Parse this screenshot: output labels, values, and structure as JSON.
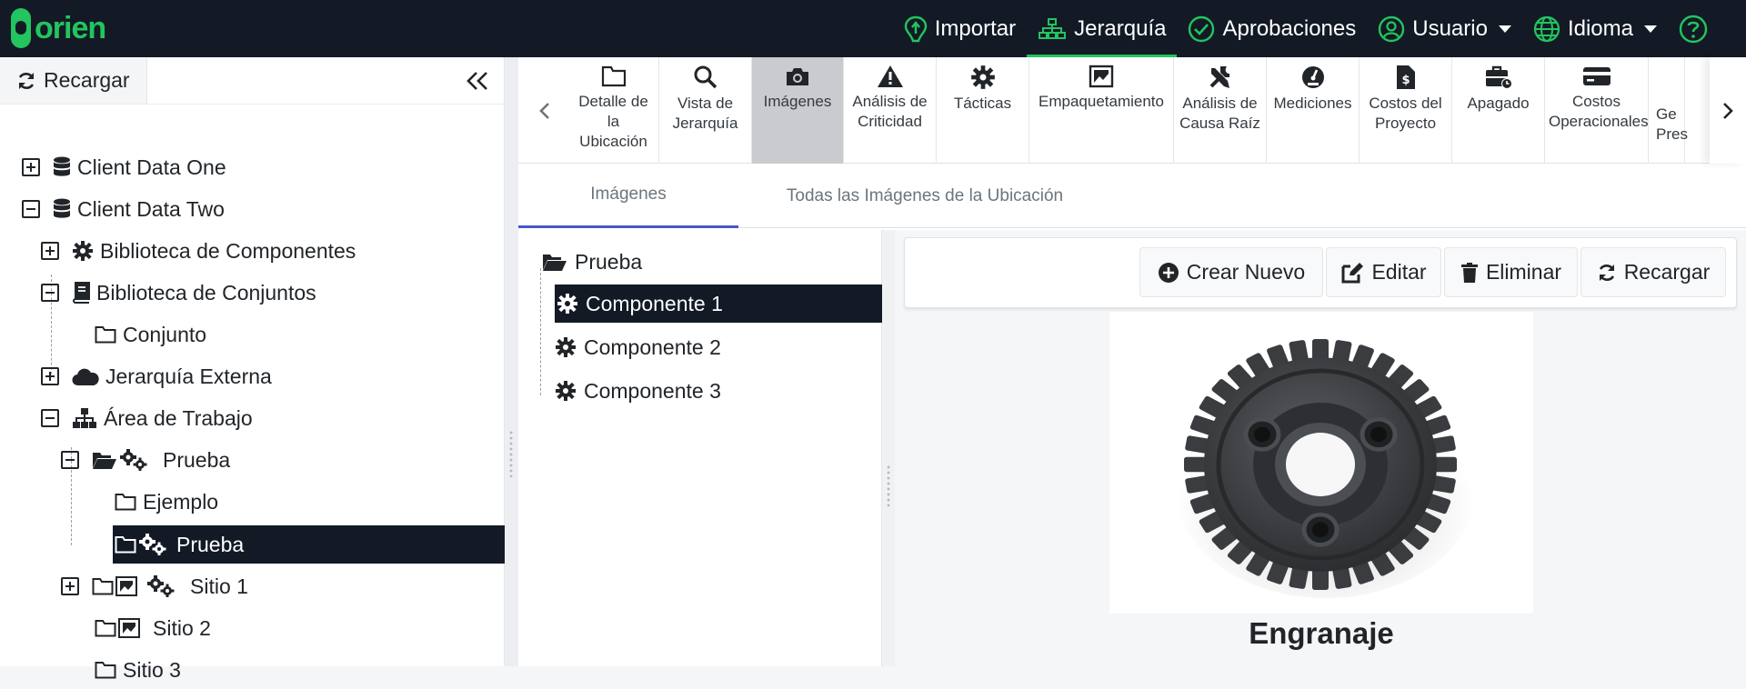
{
  "brand": {
    "name": "orien"
  },
  "nav": {
    "items": [
      {
        "label": "Importar",
        "icon": "upload-icon"
      },
      {
        "label": "Jerarquía",
        "icon": "hierarchy-icon",
        "active": true
      },
      {
        "label": "Aprobaciones",
        "icon": "check-circle-icon"
      },
      {
        "label": "Usuario",
        "icon": "user-icon",
        "dropdown": true
      },
      {
        "label": "Idioma",
        "icon": "globe-icon",
        "dropdown": true
      }
    ],
    "help_icon": "help-icon"
  },
  "sidebar": {
    "reload_label": "Recargar",
    "collapse_icon": "double-chevron-left-icon",
    "tree": [
      {
        "label": "Client Data One"
      },
      {
        "label": "Client Data Two"
      },
      {
        "label": "Biblioteca de Componentes"
      },
      {
        "label": "Biblioteca de Conjuntos"
      },
      {
        "label": "Conjunto"
      },
      {
        "label": "Jerarquía Externa"
      },
      {
        "label": "Área de Trabajo"
      },
      {
        "label": "Prueba"
      },
      {
        "label": "Ejemplo"
      },
      {
        "label": "Prueba"
      },
      {
        "label": "Sitio 1"
      },
      {
        "label": "Sitio 2"
      },
      {
        "label": "Sitio 3"
      }
    ]
  },
  "toolbar": {
    "items": [
      {
        "label": "Detalle de la Ubicación",
        "icon": "folder-icon"
      },
      {
        "label": "Vista de Jerarquía",
        "icon": "search-icon"
      },
      {
        "label": "Imágenes",
        "icon": "camera-icon",
        "active": true
      },
      {
        "label": "Análisis de Criticidad",
        "icon": "warning-icon"
      },
      {
        "label": "Tácticas",
        "icon": "gear-icon"
      },
      {
        "label": "Empaquetamiento",
        "icon": "package-icon"
      },
      {
        "label": "Análisis de Causa Raíz",
        "icon": "tools-icon"
      },
      {
        "label": "Mediciones",
        "icon": "gauge-icon"
      },
      {
        "label": "Costos del Proyecto",
        "icon": "invoice-icon"
      },
      {
        "label": "Apagado",
        "icon": "toolbox-clock-icon"
      },
      {
        "label": "Costos Operacionales",
        "icon": "credit-card-icon"
      },
      {
        "label": "Ge Pres",
        "icon": "none"
      }
    ]
  },
  "tabs": [
    {
      "label": "Imágenes",
      "active": true
    },
    {
      "label": "Todas las Imágenes de la Ubicación"
    }
  ],
  "components": {
    "root": "Prueba",
    "items": [
      "Componente 1",
      "Componente 2",
      "Componente 3"
    ],
    "selected_index": 0
  },
  "actions": {
    "create": "Crear Nuevo",
    "edit": "Editar",
    "delete": "Eliminar",
    "reload": "Recargar"
  },
  "image": {
    "caption": "Engranaje"
  },
  "colors": {
    "navbar": "#131a26",
    "brand": "#22c55e",
    "selected": "#131a26",
    "tab_active": "#4a56c9"
  }
}
